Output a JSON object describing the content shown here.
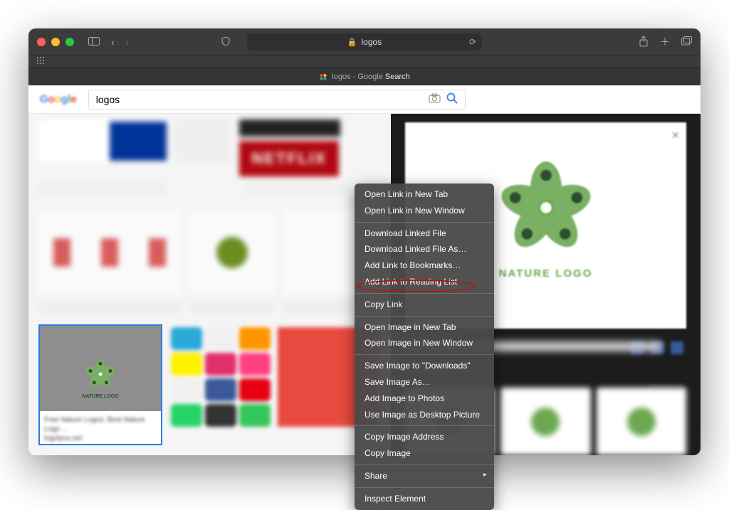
{
  "url_display": "logos",
  "tab": {
    "title_dim": "logos - Google",
    "title_bold": "Search"
  },
  "search": {
    "logo": "Google",
    "query": "logos"
  },
  "selected_result": {
    "thumb_label": "NATURE LOGO",
    "caption_line1": "Free Nature Logos: Best Nature Logo ...",
    "caption_line2": "logolynx.net"
  },
  "preview": {
    "logo_label": "NATURE LOGO"
  },
  "context_menu": {
    "items": [
      "Open Link in New Tab",
      "Open Link in New Window",
      "-",
      "Download Linked File",
      "Download Linked File As…",
      "Add Link to Bookmarks…",
      "Add Link to Reading List",
      "-",
      "Copy Link",
      "-",
      "Open Image in New Tab",
      "Open Image in New Window",
      "-",
      "Save Image to \"Downloads\"",
      "Save Image As…",
      "Add Image to Photos",
      "Use Image as Desktop Picture",
      "-",
      "Copy Image Address",
      "Copy Image",
      "-",
      "Share",
      "-",
      "Inspect Element"
    ],
    "highlighted_index": 13
  },
  "blur_text": {
    "netflix": "NETFLIX"
  }
}
